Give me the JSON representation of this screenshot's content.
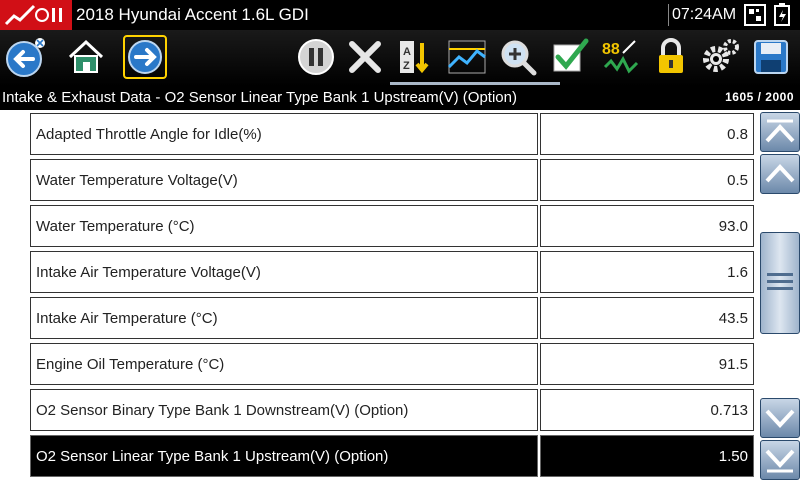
{
  "header": {
    "title": "2018 Hyundai Accent 1.6L GDI",
    "time": "07:24AM"
  },
  "toolbar": {
    "buttons": [
      {
        "name": "back-button",
        "icon": "back-arrow-icon"
      },
      {
        "name": "home-button",
        "icon": "home-icon"
      },
      {
        "name": "forward-button",
        "icon": "forward-arrow-icon",
        "selected": true
      },
      {
        "name": "pause-button",
        "icon": "pause-icon"
      },
      {
        "name": "clear-button",
        "icon": "x-icon"
      },
      {
        "name": "sort-button",
        "icon": "sort-az-icon"
      },
      {
        "name": "graph-button",
        "icon": "graph-icon"
      },
      {
        "name": "zoom-button",
        "icon": "zoom-icon"
      },
      {
        "name": "select-button",
        "icon": "checkmark-icon"
      },
      {
        "name": "units-button",
        "icon": "units-icon"
      },
      {
        "name": "lock-button",
        "icon": "lock-icon"
      },
      {
        "name": "settings-button",
        "icon": "gear-icon"
      },
      {
        "name": "save-button",
        "icon": "save-icon"
      }
    ],
    "units_label": "88",
    "recording_progress": 1.0
  },
  "breadcrumb": {
    "text": "Intake & Exhaust Data - O2 Sensor Linear Type Bank 1 Upstream(V) (Option)",
    "count": "1605 / 2000"
  },
  "rows": [
    {
      "name": "Adapted Throttle Angle for Idle(%)",
      "value": "0.8"
    },
    {
      "name": "Water Temperature Voltage(V)",
      "value": "0.5"
    },
    {
      "name": "Water Temperature (°C)",
      "value": "93.0"
    },
    {
      "name": "Intake Air Temperature Voltage(V)",
      "value": "1.6"
    },
    {
      "name": "Intake Air Temperature (°C)",
      "value": "43.5"
    },
    {
      "name": "Engine Oil Temperature (°C)",
      "value": "91.5"
    },
    {
      "name": "O2 Sensor Binary Type Bank 1 Downstream(V) (Option)",
      "value": "0.713"
    },
    {
      "name": "O2 Sensor Linear Type Bank 1 Upstream(V) (Option)",
      "value": "1.50",
      "selected": true
    }
  ],
  "colors": {
    "logo_red": "#d10f16",
    "selected_outline": "#ffd200",
    "scroll_blue": "#6c89aa"
  }
}
